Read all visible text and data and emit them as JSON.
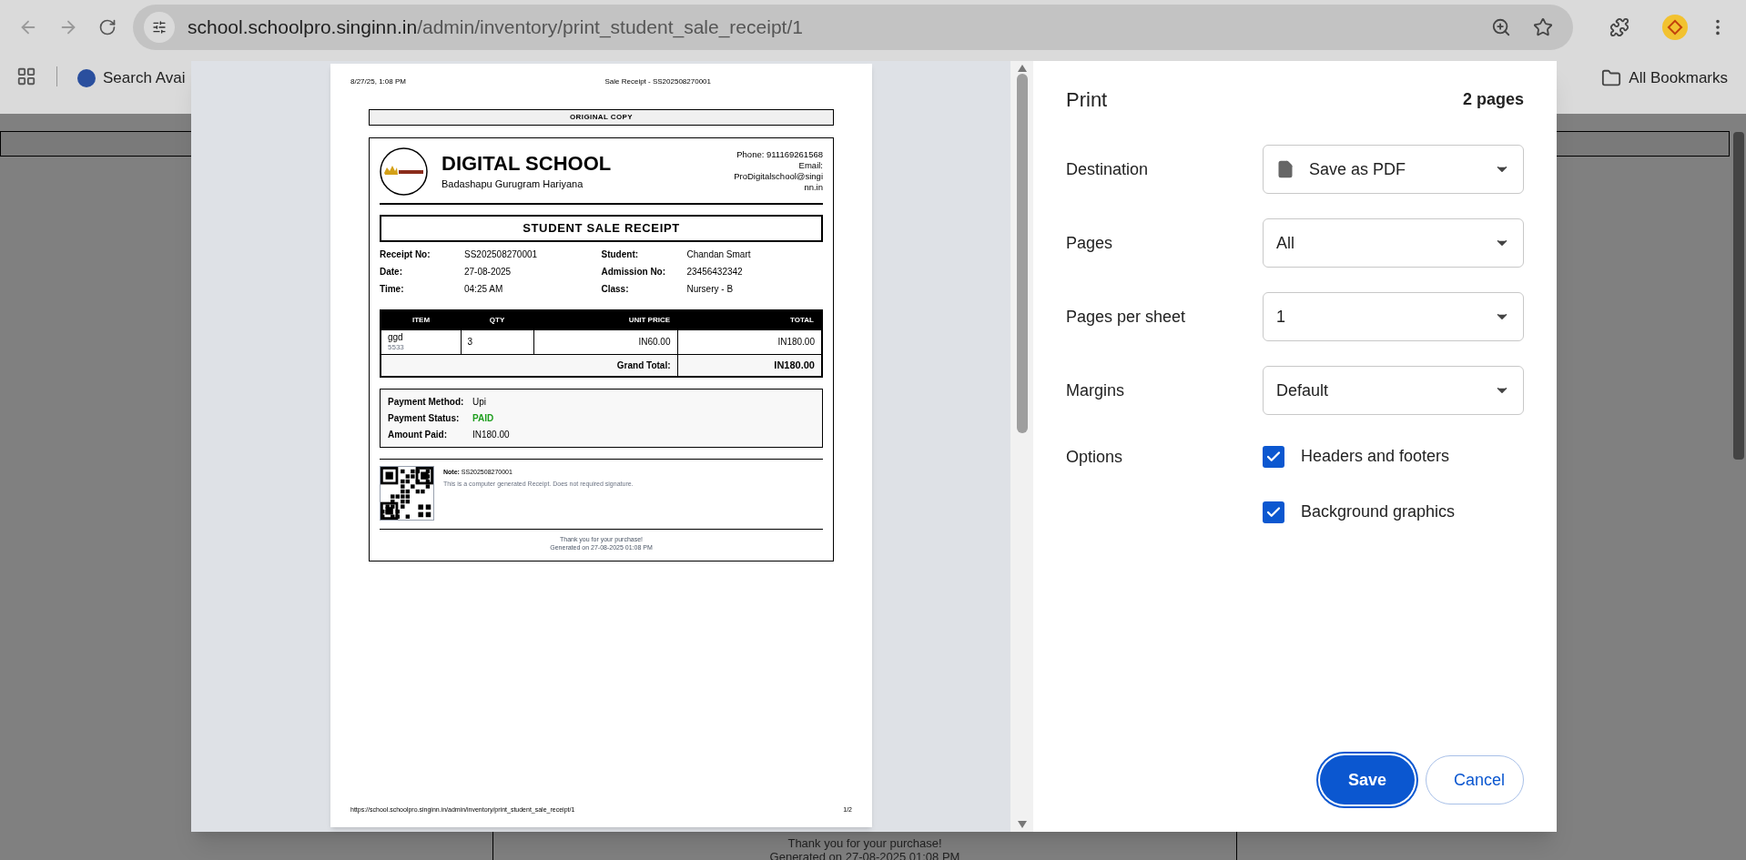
{
  "browser": {
    "url_domain": "school.schoolpro.singinn.in",
    "url_path": "/admin/inventory/print_student_sale_receipt/1",
    "bookmarks": [
      {
        "label": "Search Avai"
      }
    ],
    "all_bookmarks": "All Bookmarks"
  },
  "background_page": {
    "footer_lines": [
      "Thank you for your purchase!",
      "Generated on 27-08-2025 01:08 PM"
    ]
  },
  "preview": {
    "header_left": "8/27/25, 1:08 PM",
    "header_center": "Sale Receipt - SS202508270001",
    "copy_label": "ORIGINAL COPY",
    "school_name": "DIGITAL SCHOOL",
    "school_address": "Badashapu Gurugram Hariyana",
    "contact_lines": [
      "Phone: 911169261568",
      "Email:",
      "ProDigitalschool@singi",
      "nn.in"
    ],
    "receipt_title": "STUDENT SALE RECEIPT",
    "details_left": [
      {
        "label": "Receipt No:",
        "value": "SS202508270001"
      },
      {
        "label": "Date:",
        "value": "27-08-2025"
      },
      {
        "label": "Time:",
        "value": "04:25 AM"
      }
    ],
    "details_right": [
      {
        "label": "Student:",
        "value": "Chandan Smart"
      },
      {
        "label": "Admission No:",
        "value": "23456432342"
      },
      {
        "label": "Class:",
        "value": "Nursery - B"
      }
    ],
    "columns": [
      "ITEM",
      "QTY",
      "UNIT PRICE",
      "TOTAL"
    ],
    "rows": [
      {
        "item": "ggd",
        "code": "5533",
        "qty": "3",
        "unit_price": "IN60.00",
        "total": "IN180.00"
      }
    ],
    "grand_total_label": "Grand Total:",
    "grand_total": "IN180.00",
    "payment": [
      {
        "label": "Payment Method:",
        "value": "Upi",
        "kind": "text"
      },
      {
        "label": "Payment Status:",
        "value": "PAID",
        "kind": "status"
      },
      {
        "label": "Amount Paid:",
        "value": "IN180.00",
        "kind": "text"
      }
    ],
    "note_label": "Note:",
    "note_value": "SS202508270001",
    "note_text": "This is a computer generated Receipt. Does not required signature.",
    "thank_you": "Thank you for your purchase!",
    "generated": "Generated on 27-08-2025 01:08 PM",
    "footer_url": "https://school.schoolpro.singinn.in/admin/inventory/print_student_sale_receipt/1",
    "footer_page": "1/2"
  },
  "print_panel": {
    "title": "Print",
    "page_count": "2 pages",
    "settings": [
      {
        "label": "Destination",
        "value": "Save as PDF",
        "icon": true
      },
      {
        "label": "Pages",
        "value": "All",
        "icon": false
      },
      {
        "label": "Pages per sheet",
        "value": "1",
        "icon": false
      },
      {
        "label": "Margins",
        "value": "Default",
        "icon": false
      }
    ],
    "options_label": "Options",
    "options": [
      {
        "label": "Headers and footers",
        "checked": true
      },
      {
        "label": "Background graphics",
        "checked": true
      }
    ],
    "buttons": [
      {
        "label": "Save",
        "selected": true
      },
      {
        "label": "Cancel",
        "selected": false
      }
    ]
  }
}
